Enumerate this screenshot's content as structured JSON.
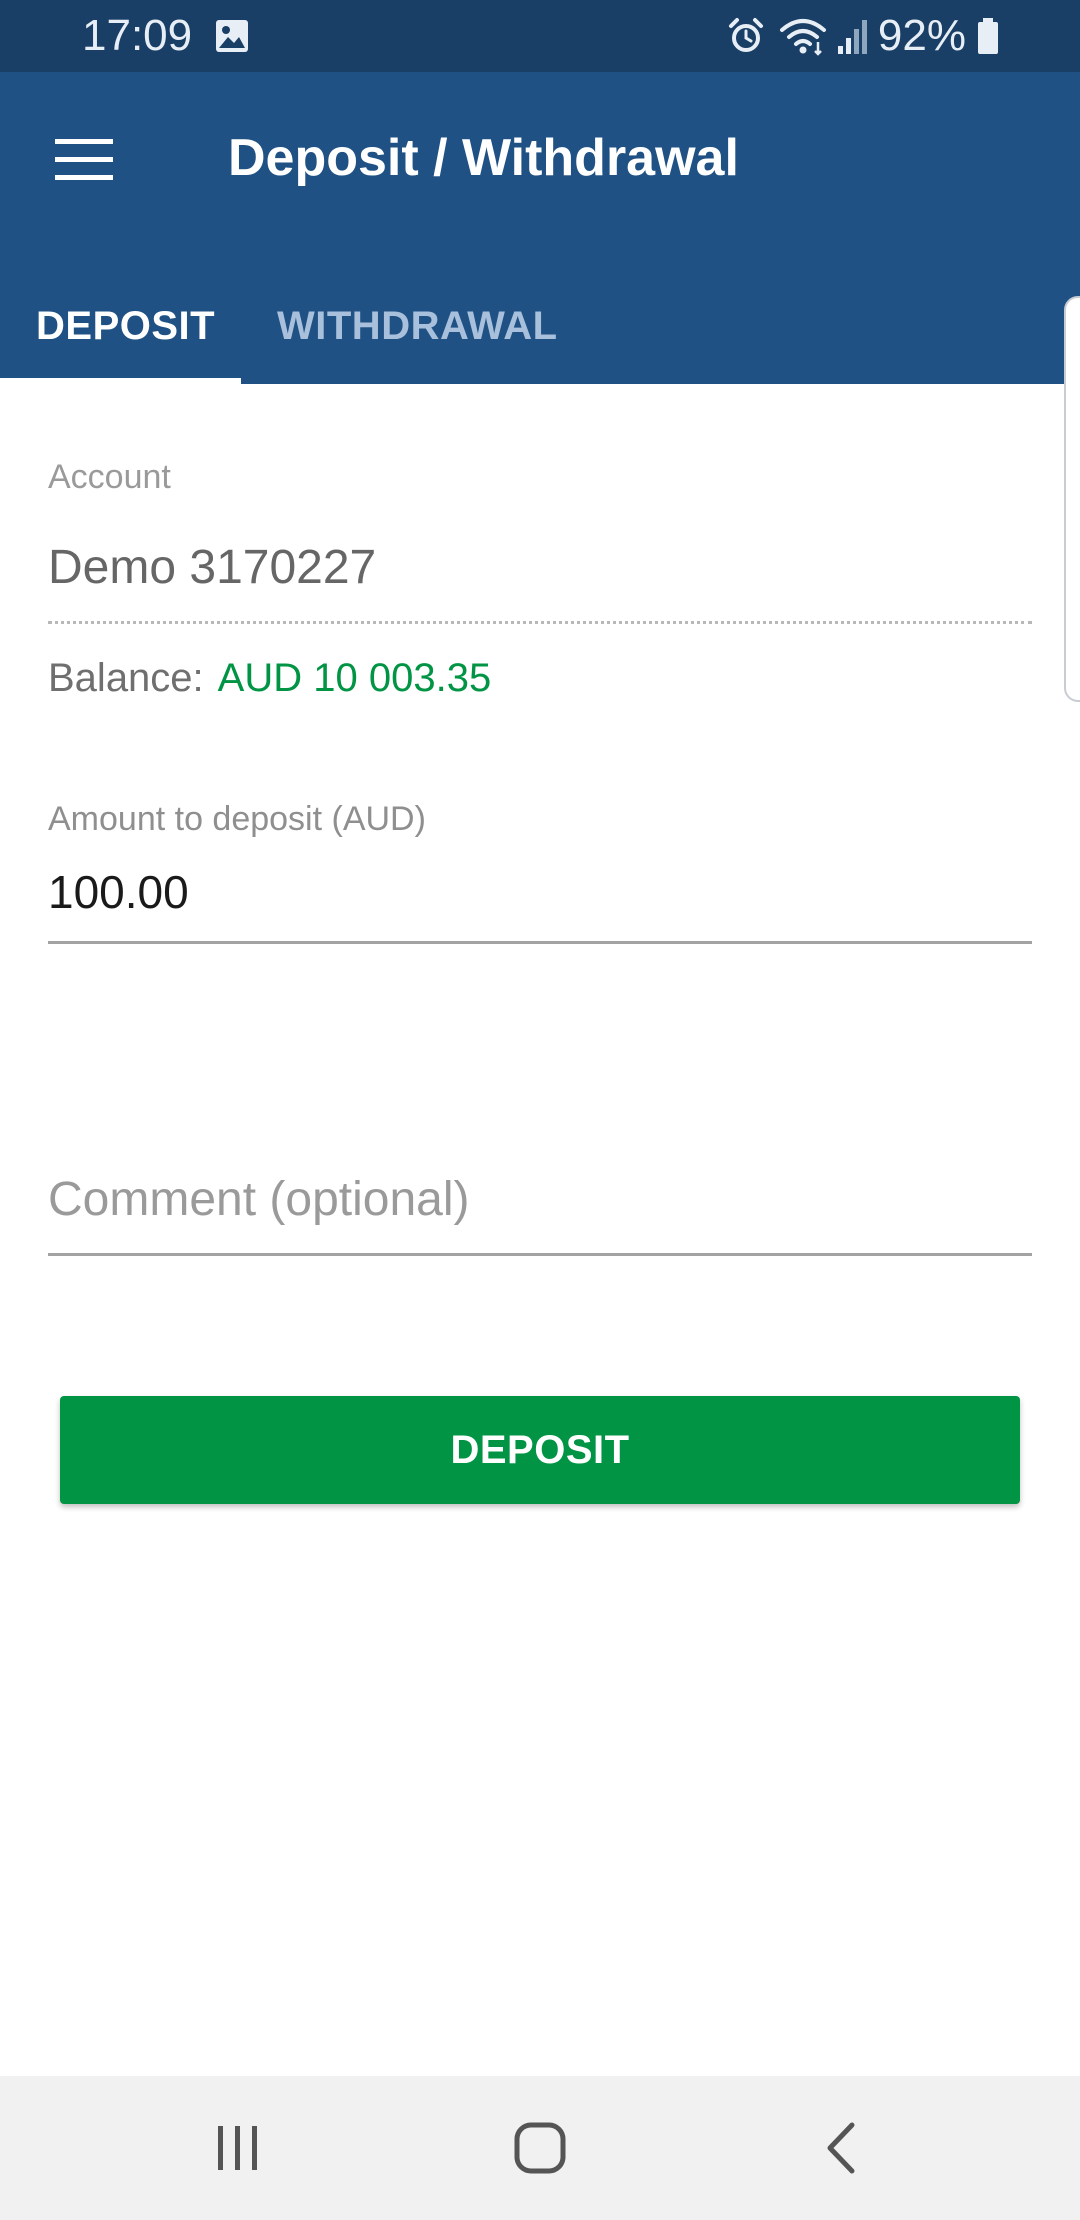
{
  "status_bar": {
    "time": "17:09",
    "battery": "92%",
    "icons": [
      "gallery-icon",
      "alarm-icon",
      "wifi-icon",
      "signal-icon",
      "battery-icon"
    ]
  },
  "app_bar": {
    "title": "Deposit / Withdrawal",
    "menu_icon": "hamburger-menu-icon"
  },
  "tabs": [
    {
      "label": "DEPOSIT",
      "selected": true
    },
    {
      "label": "WITHDRAWAL",
      "selected": false
    }
  ],
  "form": {
    "account_label": "Account",
    "account_value": "Demo 3170227",
    "balance_label": "Balance:",
    "balance_value": "AUD 10 003.35",
    "amount_label": "Amount to deposit (AUD)",
    "amount_value": "100.00",
    "comment_placeholder": "Comment (optional)",
    "comment_value": ""
  },
  "action": {
    "deposit_label": "DEPOSIT"
  },
  "nav_bar": {
    "icons": [
      "recents-icon",
      "home-icon",
      "back-icon"
    ]
  },
  "colors": {
    "status_bar": "#1a3f66",
    "app_bar": "#1f5184",
    "accent_green": "#009444",
    "background": "#ffffff"
  }
}
